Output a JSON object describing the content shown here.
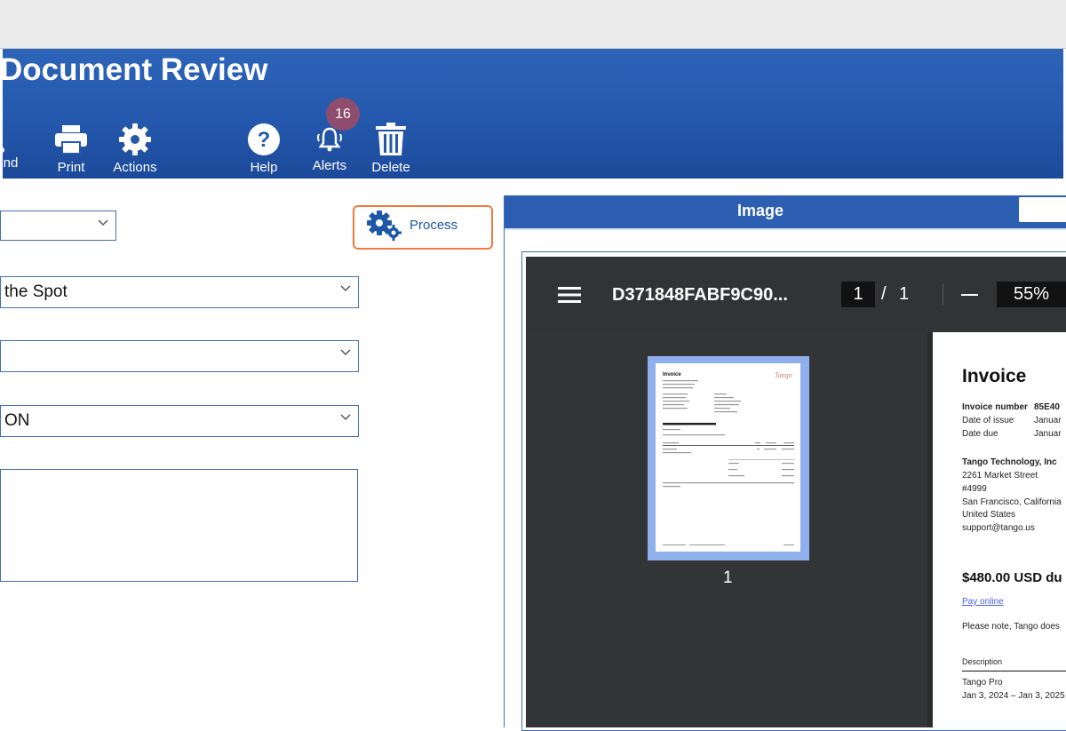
{
  "app": {
    "title": "Document Review"
  },
  "toolbar": {
    "find_label": "nd",
    "print_label": "Print",
    "actions_label": "Actions",
    "help_label": "Help",
    "alerts_label": "Alerts",
    "alerts_count": "16",
    "delete_label": "Delete"
  },
  "form": {
    "select1_value": "",
    "select2_value": "the Spot",
    "select3_value": "",
    "select4_value": "ON",
    "notes_value": ""
  },
  "process": {
    "label": "Process"
  },
  "image_panel": {
    "tab_label": "Image"
  },
  "pdf": {
    "file_name": "D371848FABF9C90...",
    "current_page": "1",
    "separator": "/",
    "total_pages": "1",
    "zoom": "55%",
    "thumbnail_page_number": "1"
  },
  "invoice": {
    "title": "Invoice",
    "invoice_number_label": "Invoice number",
    "invoice_number_value": "85E40",
    "date_of_issue_label": "Date of issue",
    "date_of_issue_value": "Januar",
    "date_due_label": "Date due",
    "date_due_value": "Januar",
    "company": "Tango Technology, Inc",
    "address_line1": "2261 Market Street",
    "address_line2": "#4999",
    "address_line3": "San Francisco, California",
    "country": "United States",
    "email": "support@tango.us",
    "amount_due": "$480.00 USD du",
    "pay_online": "Pay online",
    "note": "Please note, Tango does",
    "description_header": "Description",
    "item_name": "Tango Pro",
    "item_period": "Jan 3, 2024 – Jan 3, 2025",
    "thumb_brand": "Tango"
  },
  "colors": {
    "header_blue": "#2458ad",
    "badge": "#8e4d6e",
    "process_border": "#f07b3f",
    "pdf_dark": "#2b2c2e",
    "thumb_highlight": "#8fb0ec"
  }
}
